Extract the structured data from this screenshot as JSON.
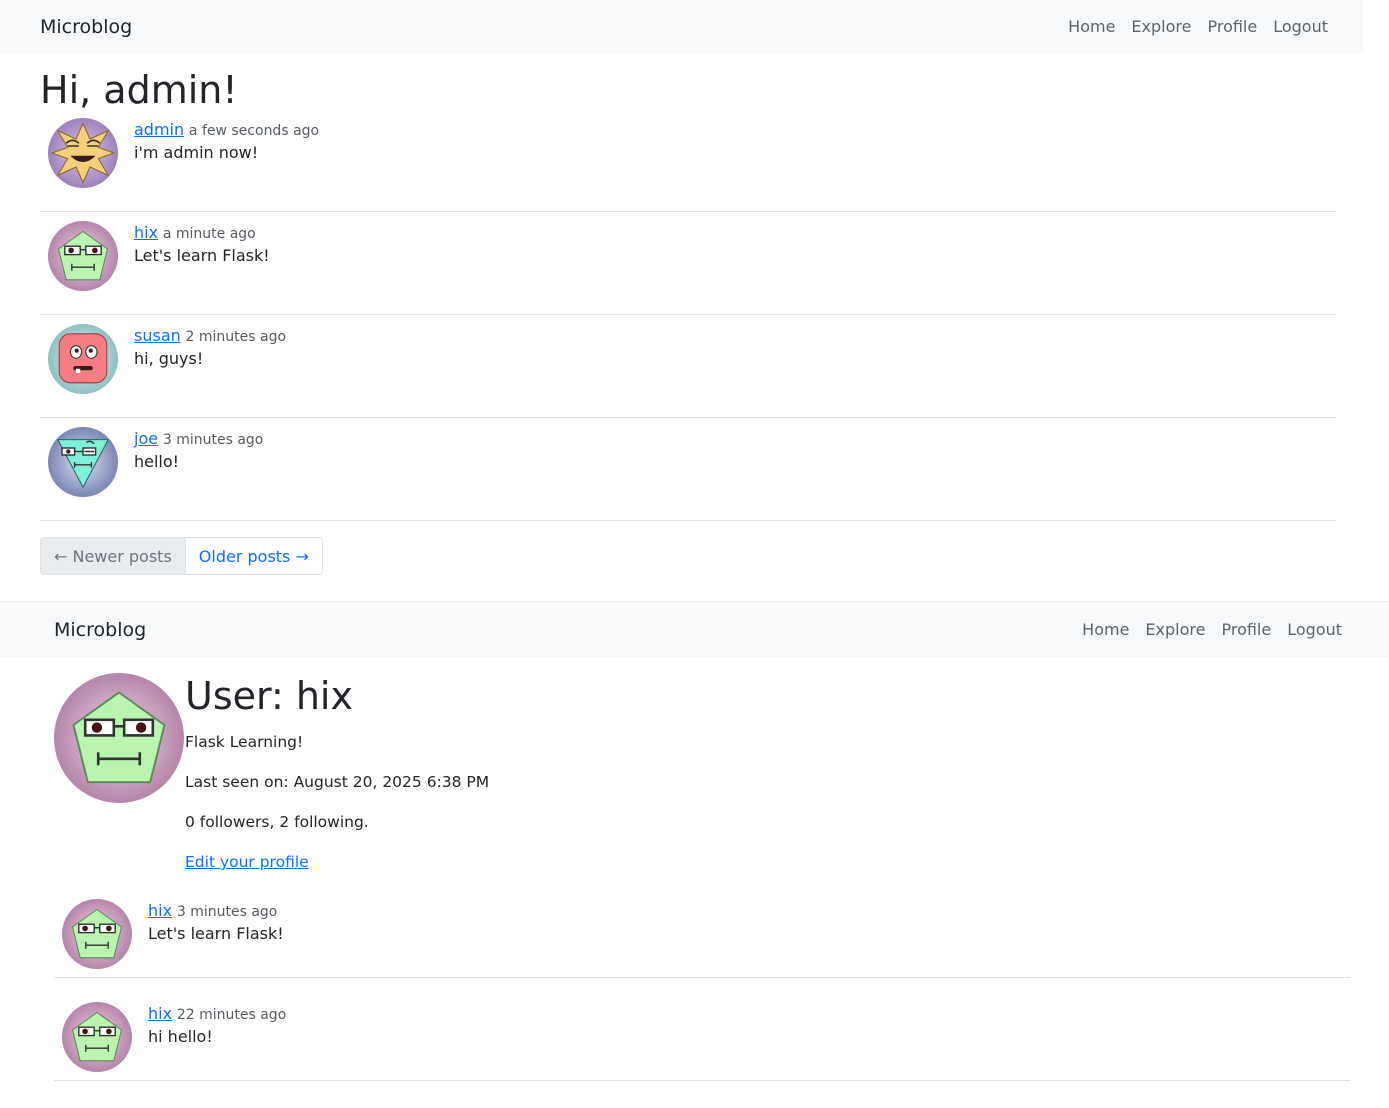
{
  "nav": {
    "brand": "Microblog",
    "links": [
      "Home",
      "Explore",
      "Profile",
      "Logout"
    ]
  },
  "index": {
    "title": "Hi, admin!",
    "posts": [
      {
        "user": "admin",
        "time": "a few seconds ago",
        "body": "i'm admin now!",
        "avatar": "star-face-avatar"
      },
      {
        "user": "hix",
        "time": "a minute ago",
        "body": "Let's learn Flask!",
        "avatar": "pentagon-face-avatar"
      },
      {
        "user": "susan",
        "time": "2 minutes ago",
        "body": "hi, guys!",
        "avatar": "square-face-avatar"
      },
      {
        "user": "joe",
        "time": "3 minutes ago",
        "body": "hello!",
        "avatar": "triangle-face-avatar"
      }
    ],
    "pagination": {
      "newer": "← Newer posts",
      "older": "Older posts →"
    }
  },
  "profile": {
    "title": "User: hix",
    "about": "Flask Learning!",
    "last_seen": "Last seen on: August 20, 2025 6:38 PM",
    "follow_stats": "0 followers, 2 following.",
    "edit_link": "Edit your profile",
    "avatar": "pentagon-face-avatar",
    "posts": [
      {
        "user": "hix",
        "time": "3 minutes ago",
        "body": "Let's learn Flask!",
        "avatar": "pentagon-face-avatar"
      },
      {
        "user": "hix",
        "time": "22 minutes ago",
        "body": "hi hello!",
        "avatar": "pentagon-face-avatar"
      }
    ]
  },
  "colors": {
    "link": "#0d6efd",
    "navbar_bg": "#f8f9fa",
    "muted": "#6c757d"
  }
}
